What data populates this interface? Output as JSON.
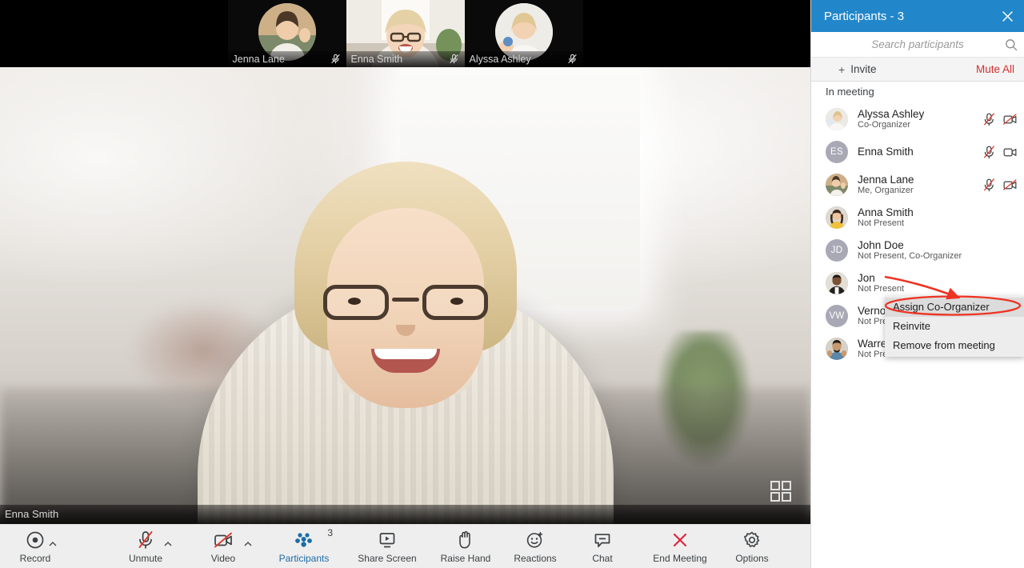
{
  "stage": {
    "speaker_name": "Enna Smith",
    "grid_icon": "grid-layout-icon",
    "thumbnails": [
      {
        "name": "Jenna Lane",
        "mic": "mic-muted-icon",
        "active": false
      },
      {
        "name": "Enna Smith",
        "mic": "mic-muted-icon",
        "active": true
      },
      {
        "name": "Alyssa Ashley",
        "mic": "mic-muted-icon",
        "active": false
      }
    ]
  },
  "toolbar": {
    "items": [
      {
        "label": "Record",
        "icon": "record-icon",
        "caret": true,
        "badge": "",
        "active": false
      },
      {
        "label": "Unmute",
        "icon": "mic-muted-icon",
        "caret": true,
        "badge": "",
        "active": false
      },
      {
        "label": "Video",
        "icon": "video-off-icon",
        "caret": true,
        "badge": "",
        "active": false
      },
      {
        "label": "Participants",
        "icon": "participants-icon",
        "caret": false,
        "badge": "3",
        "active": true
      },
      {
        "label": "Share Screen",
        "icon": "share-screen-icon",
        "caret": false,
        "badge": "",
        "active": false
      },
      {
        "label": "Raise Hand",
        "icon": "raise-hand-icon",
        "caret": false,
        "badge": "",
        "active": false
      },
      {
        "label": "Reactions",
        "icon": "reactions-icon",
        "caret": false,
        "badge": "",
        "active": false
      },
      {
        "label": "Chat",
        "icon": "chat-icon",
        "caret": false,
        "badge": "",
        "active": false
      },
      {
        "label": "End Meeting",
        "icon": "end-meeting-icon",
        "caret": false,
        "badge": "",
        "active": false
      },
      {
        "label": "Options",
        "icon": "gear-icon",
        "caret": false,
        "badge": "",
        "active": false
      }
    ]
  },
  "panel": {
    "title": "Participants - 3",
    "close_icon": "close-icon",
    "search": {
      "placeholder": "Search participants",
      "value": "",
      "icon": "search-icon"
    },
    "invite_label": "Invite",
    "invite_plus": "+",
    "mute_all_label": "Mute All",
    "section_label": "In meeting",
    "participants": [
      {
        "name": "Alyssa Ashley",
        "sub": "Co-Organizer",
        "initials": "",
        "photo": true,
        "mic": "mic-muted-icon",
        "video": "video-off-icon"
      },
      {
        "name": "Enna Smith",
        "sub": "",
        "initials": "ES",
        "photo": false,
        "mic": "mic-muted-icon",
        "video": "video-on-icon"
      },
      {
        "name": "Jenna Lane",
        "sub": "Me, Organizer",
        "initials": "",
        "photo": true,
        "mic": "mic-muted-icon",
        "video": "video-off-icon"
      },
      {
        "name": "Anna Smith",
        "sub": "Not Present",
        "initials": "",
        "photo": true,
        "mic": "",
        "video": ""
      },
      {
        "name": "John Doe",
        "sub": "Not Present, Co-Organizer",
        "initials": "JD",
        "photo": false,
        "mic": "",
        "video": ""
      },
      {
        "name": "Jon",
        "sub": "Not Present",
        "initials": "",
        "photo": true,
        "mic": "",
        "video": ""
      },
      {
        "name": "Vernon White",
        "sub": "Not Present",
        "initials": "VW",
        "photo": false,
        "mic": "",
        "video": ""
      },
      {
        "name": "Warren Bright",
        "sub": "Not Present",
        "initials": "",
        "photo": true,
        "mic": "",
        "video": ""
      }
    ]
  },
  "context_menu": {
    "items": [
      {
        "label": "Assign Co-Organizer",
        "highlighted": true
      },
      {
        "label": "Reinvite",
        "highlighted": false
      },
      {
        "label": "Remove from meeting",
        "highlighted": false
      }
    ]
  },
  "annotation": {
    "color": "#ee3322",
    "arrow": "red-arrow-annotation",
    "ellipse": "red-ellipse-annotation"
  },
  "colors": {
    "panel_header": "#2287ca",
    "accent_blue": "#1b6ca8",
    "danger_red": "#d32f2f",
    "toolbar_bg": "#eeeeee",
    "annotation_red": "#ee3322"
  }
}
